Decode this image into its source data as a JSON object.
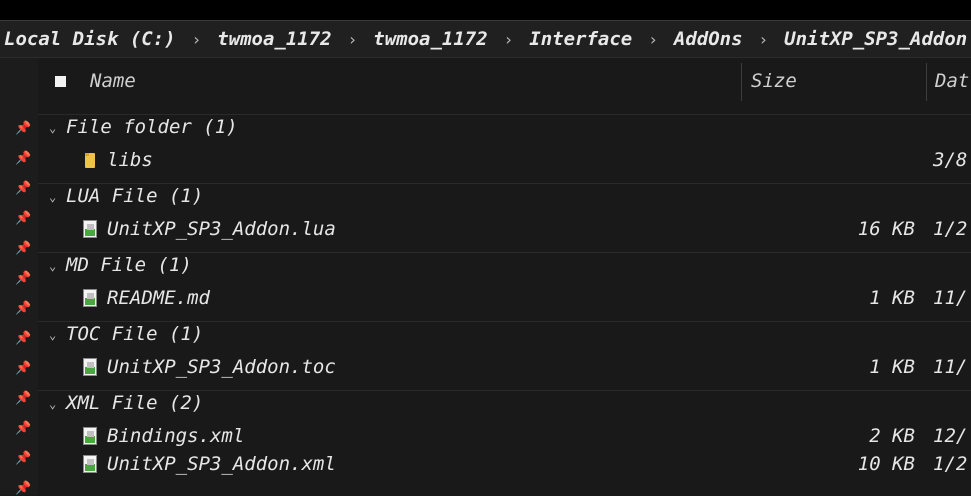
{
  "breadcrumb": {
    "items": [
      "Local Disk (C:)",
      "twmoa_1172",
      "twmoa_1172",
      "Interface",
      "AddOns",
      "UnitXP_SP3_Addon"
    ],
    "separator": "›"
  },
  "columns": {
    "name": "Name",
    "size": "Size",
    "date": "Dat"
  },
  "groups": [
    {
      "label": "File folder (1)",
      "files": [
        {
          "name": "libs",
          "size": "",
          "date": "3/8",
          "icon": "folder-icon"
        }
      ]
    },
    {
      "label": "LUA File (1)",
      "files": [
        {
          "name": "UnitXP_SP3_Addon.lua",
          "size": "16 KB",
          "date": "1/2",
          "icon": "file-icon"
        }
      ]
    },
    {
      "label": "MD File (1)",
      "files": [
        {
          "name": "README.md",
          "size": "1 KB",
          "date": "11/",
          "icon": "file-icon"
        }
      ]
    },
    {
      "label": "TOC File (1)",
      "files": [
        {
          "name": "UnitXP_SP3_Addon.toc",
          "size": "1 KB",
          "date": "11/",
          "icon": "file-icon"
        }
      ]
    },
    {
      "label": "XML File (2)",
      "files": [
        {
          "name": "Bindings.xml",
          "size": "2 KB",
          "date": "12/",
          "icon": "file-icon"
        },
        {
          "name": "UnitXP_SP3_Addon.xml",
          "size": "10 KB",
          "date": "1/2",
          "icon": "file-icon"
        }
      ]
    }
  ],
  "icons": {
    "chevron": "⌄",
    "pin": "📌"
  },
  "colors": {
    "background": "#191919",
    "folder": "#f0c24a",
    "file_accent": "#47a83f"
  }
}
